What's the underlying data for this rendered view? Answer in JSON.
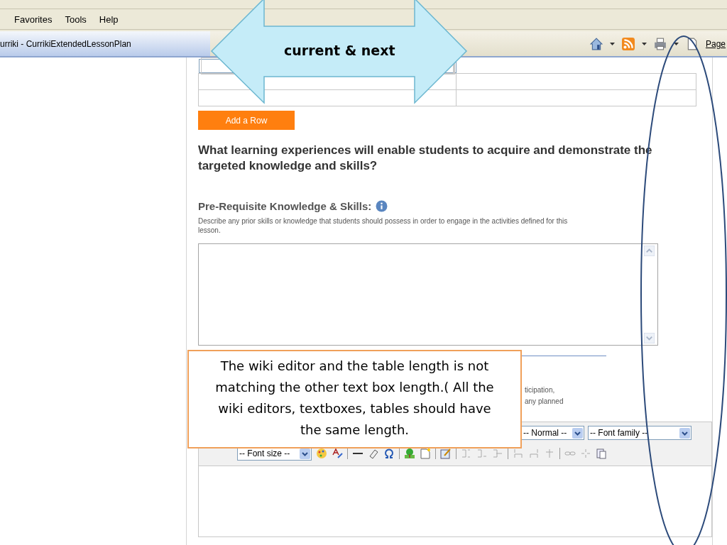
{
  "browser": {
    "menu": [
      "Favorites",
      "Tools",
      "Help"
    ],
    "tab_title": "urriki - CurrikiExtendedLessonPlan",
    "page_label": "Page"
  },
  "lesson": {
    "table_rows": [
      {
        "selected": true
      },
      {
        "selected": false
      },
      {
        "selected": false
      }
    ],
    "add_row_button": "Add a Row",
    "question": "What learning experiences will enable students to acquire and demonstrate the targeted knowledge and skills?",
    "prerequisite": {
      "title": "Pre-Requisite Knowledge & Skills:",
      "description": "Describe any prior skills or knowledge that students should possess in order to engage in the activities defined for this lesson."
    },
    "partial_lines": [
      "ticipation,",
      "any planned"
    ],
    "editor": {
      "format_select": "-- Normal --",
      "font_family_select": "-- Font family --",
      "font_size_select": "-- Font size --"
    }
  },
  "annotations": {
    "arrow_label": "current & next",
    "note": "The wiki editor and the table length is not matching the other text box length.( All the wiki editors, textboxes, tables should have the same length."
  }
}
